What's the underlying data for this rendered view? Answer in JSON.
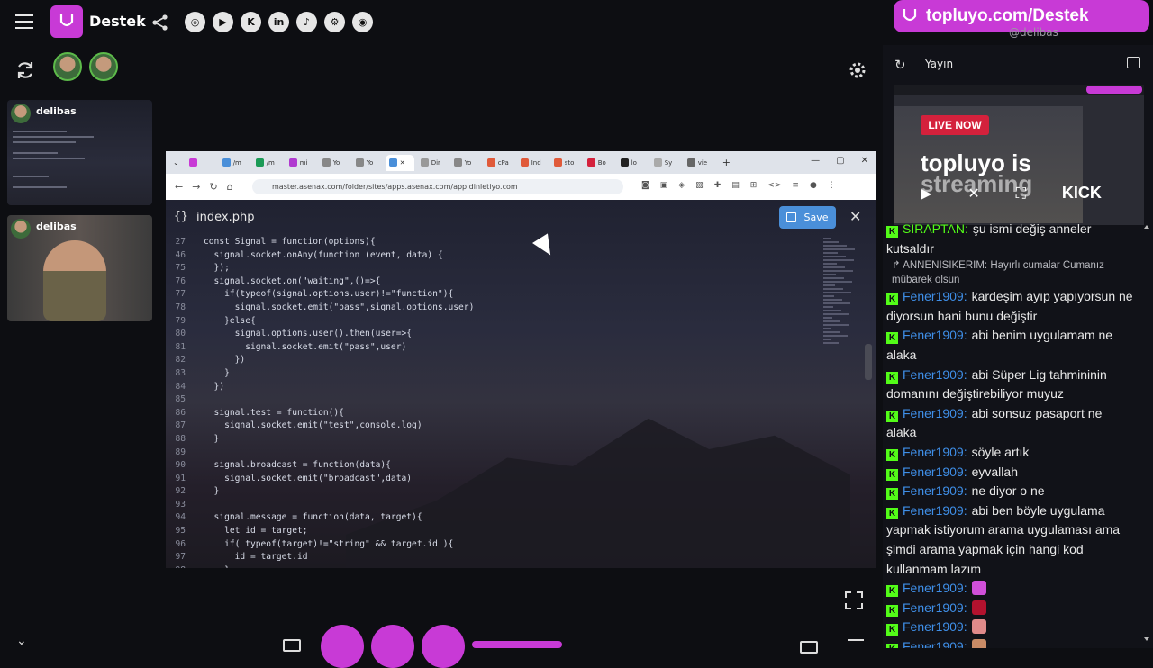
{
  "brand": "Destek",
  "banner": {
    "text": "topluyo.com/Destek",
    "sub": "@delibas"
  },
  "socials": [
    "instagram-icon",
    "youtube-icon",
    "kick-icon",
    "linkedin-icon",
    "tiktok-icon",
    "steam-icon",
    "github-icon"
  ],
  "thumbnails": [
    {
      "name": "delibas"
    },
    {
      "name": "delibas"
    }
  ],
  "browser": {
    "tabs": [
      "/m",
      "/m",
      "mi",
      "Yo",
      "Yo",
      "",
      "Dir",
      "Yo",
      "cPa",
      "Ind",
      "sto",
      "Bo",
      "lo",
      "Sy",
      "vie"
    ],
    "url": "master.asenax.com/folder/sites/apps.asenax.com/app.dinletiyo.com"
  },
  "editor": {
    "file_icon": "{}",
    "file_name": "index.php",
    "save_label": "Save",
    "lines": [
      {
        "n": "27",
        "code": "const Signal = function(options){"
      },
      {
        "n": "46",
        "code": "  signal.socket.onAny(function (event, data) {"
      },
      {
        "n": "75",
        "code": "  });"
      },
      {
        "n": "76",
        "code": "  signal.socket.on(\"waiting\",()=>{"
      },
      {
        "n": "77",
        "code": "    if(typeof(signal.options.user)!=\"function\"){"
      },
      {
        "n": "78",
        "code": "      signal.socket.emit(\"pass\",signal.options.user)"
      },
      {
        "n": "79",
        "code": "    }else{"
      },
      {
        "n": "80",
        "code": "      signal.options.user().then(user=>{"
      },
      {
        "n": "81",
        "code": "        signal.socket.emit(\"pass\",user)"
      },
      {
        "n": "82",
        "code": "      })"
      },
      {
        "n": "83",
        "code": "    }"
      },
      {
        "n": "84",
        "code": "  })"
      },
      {
        "n": "85",
        "code": ""
      },
      {
        "n": "86",
        "code": "  signal.test = function(){"
      },
      {
        "n": "87",
        "code": "    signal.socket.emit(\"test\",console.log)"
      },
      {
        "n": "88",
        "code": "  }"
      },
      {
        "n": "89",
        "code": ""
      },
      {
        "n": "90",
        "code": "  signal.broadcast = function(data){"
      },
      {
        "n": "91",
        "code": "    signal.socket.emit(\"broadcast\",data)"
      },
      {
        "n": "92",
        "code": "  }"
      },
      {
        "n": "93",
        "code": ""
      },
      {
        "n": "94",
        "code": "  signal.message = function(data, target){"
      },
      {
        "n": "95",
        "code": "    let id = target;"
      },
      {
        "n": "96",
        "code": "    if( typeof(target)!=\"string\" && target.id ){"
      },
      {
        "n": "97",
        "code": "      id = target.id"
      },
      {
        "n": "98",
        "code": "    }"
      }
    ]
  },
  "right_panel": {
    "title": "Yayın",
    "live_badge": "LIVE NOW",
    "preview_text": "topluyo is",
    "preview_text2": "streaming",
    "kick": "KICK"
  },
  "chat": [
    {
      "user": "SIRAPTAN:",
      "text": "şu ismi değiş anneler kutsaldır",
      "user_color": "green"
    },
    {
      "reply": "↱ ANNENISIKERIM: Hayırlı cumalar Cumanız mübarek olsun"
    },
    {
      "user": "Fener1909:",
      "text": "kardeşim ayıp yapıyorsun ne diyorsun hani bunu değiştir"
    },
    {
      "user": "Fener1909:",
      "text": "abi benim uygulamam ne alaka"
    },
    {
      "user": "Fener1909:",
      "text": "abi Süper Lig tahmininin domanını değiştirebiliyor muyuz"
    },
    {
      "user": "Fener1909:",
      "text": "abi sonsuz pasaport ne alaka"
    },
    {
      "user": "Fener1909:",
      "text": "söyle artık"
    },
    {
      "user": "Fener1909:",
      "text": "eyvallah"
    },
    {
      "user": "Fener1909:",
      "text": "ne diyor o ne"
    },
    {
      "user": "Fener1909:",
      "text": "abi ben böyle uygulama yapmak istiyorum arama uygulaması ama şimdi arama yapmak için hangi kod kullanmam lazım"
    },
    {
      "user": "Fener1909:",
      "text": "",
      "emote": "#d04fd8"
    },
    {
      "user": "Fener1909:",
      "text": "",
      "emote": "#b3122e"
    },
    {
      "user": "Fener1909:",
      "text": "",
      "emote": "#e08a8a"
    },
    {
      "user": "Fener1909:",
      "text": "",
      "emote": "#c98b66"
    }
  ],
  "colors": {
    "accent": "#c83ad6",
    "kick_green": "#53fc18",
    "chat_user": "#3f8fe8",
    "save": "#4a8fd9"
  }
}
